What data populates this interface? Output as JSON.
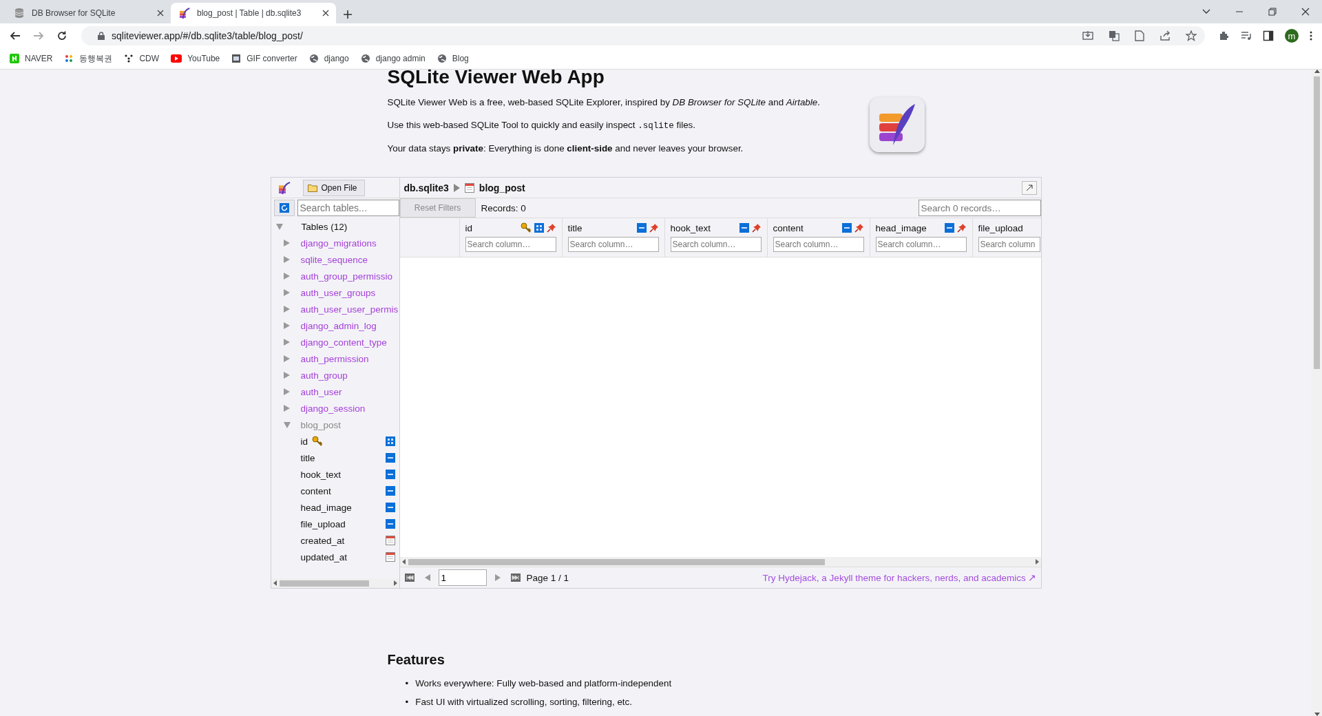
{
  "browser": {
    "tabs": [
      {
        "title": "DB Browser for SQLite",
        "selected": false,
        "kind": "database"
      },
      {
        "title": "blog_post | Table | db.sqlite3",
        "selected": true,
        "kind": "feather"
      }
    ],
    "url": "sqliteviewer.app/#/db.sqlite3/table/blog_post/",
    "bookmarks": [
      {
        "label": "NAVER",
        "kind": "naver"
      },
      {
        "label": "동행복권",
        "kind": "lottery"
      },
      {
        "label": "CDW",
        "kind": "dots"
      },
      {
        "label": "YouTube",
        "kind": "youtube"
      },
      {
        "label": "GIF converter",
        "kind": "gif"
      },
      {
        "label": "django",
        "kind": "globe"
      },
      {
        "label": "django admin",
        "kind": "globe"
      },
      {
        "label": "Blog",
        "kind": "globe"
      }
    ],
    "profile_initial": "m"
  },
  "page": {
    "title": "SQLite Viewer Web App",
    "intro": [
      "SQLite Viewer Web is a free, web-based SQLite Explorer, inspired by *DB Browser for SQLite* and *Airtable*.",
      {
        "before": "Use this web-based SQLite Tool to quickly and easily inspect ",
        "code": ".sqlite",
        "after": " files."
      },
      "Your data stays **private**: Everything is done **client-side** and never leaves your browser."
    ],
    "features_title": "Features",
    "features": [
      {
        "bullet": "•",
        "text": "Works everywhere: Fully web-based and platform-independent"
      },
      {
        "bullet": "•",
        "text": "Fast UI with virtualized scrolling, sorting, filtering, etc."
      }
    ]
  },
  "viewer": {
    "open_file": "Open File",
    "search_tables_placeholder": "Search tables...",
    "tree": {
      "label": "Tables (12)",
      "expanded": true,
      "children": [
        {
          "name": "django_migrations",
          "expanded": false,
          "selected": false
        },
        {
          "name": "sqlite_sequence",
          "expanded": false,
          "selected": false
        },
        {
          "name": "auth_group_permissio",
          "expanded": false,
          "selected": false
        },
        {
          "name": "auth_user_groups",
          "expanded": false,
          "selected": false
        },
        {
          "name": "auth_user_user_permis",
          "expanded": false,
          "selected": false
        },
        {
          "name": "django_admin_log",
          "expanded": false,
          "selected": false
        },
        {
          "name": "django_content_type",
          "expanded": false,
          "selected": false
        },
        {
          "name": "auth_permission",
          "expanded": false,
          "selected": false
        },
        {
          "name": "auth_group",
          "expanded": false,
          "selected": false
        },
        {
          "name": "auth_user",
          "expanded": false,
          "selected": false
        },
        {
          "name": "django_session",
          "expanded": false,
          "selected": false
        },
        {
          "name": "blog_post",
          "expanded": true,
          "selected": true,
          "children": [
            {
              "name": "id",
              "kind": "integer",
              "primary_key": true
            },
            {
              "name": "title",
              "kind": "text",
              "primary_key": false
            },
            {
              "name": "hook_text",
              "kind": "text",
              "primary_key": false
            },
            {
              "name": "content",
              "kind": "text",
              "primary_key": false
            },
            {
              "name": "head_image",
              "kind": "text",
              "primary_key": false
            },
            {
              "name": "file_upload",
              "kind": "text",
              "primary_key": false
            },
            {
              "name": "created_at",
              "kind": "datetime",
              "primary_key": false
            },
            {
              "name": "updated_at",
              "kind": "datetime",
              "primary_key": false
            }
          ]
        }
      ]
    },
    "breadcrumb": {
      "database": "db.sqlite3",
      "table": "blog_post"
    },
    "reset_filters": {
      "label": "Reset Filters",
      "disabled": true
    },
    "records": "Records: 0",
    "search_records_placeholder": "Search 0 records…",
    "columns": [
      {
        "name": "id",
        "kind": "integer",
        "primary_key": true,
        "placeholder": "Search column…"
      },
      {
        "name": "title",
        "kind": "text",
        "primary_key": false,
        "placeholder": "Search column…"
      },
      {
        "name": "hook_text",
        "kind": "text",
        "primary_key": false,
        "placeholder": "Search column…"
      },
      {
        "name": "content",
        "kind": "text",
        "primary_key": false,
        "placeholder": "Search column…"
      },
      {
        "name": "head_image",
        "kind": "text",
        "primary_key": false,
        "placeholder": "Search column…"
      },
      {
        "name": "file_upload",
        "primary_key": false,
        "placeholder": "Search column"
      }
    ],
    "page_input": "1",
    "page_label": "Page 1 / 1",
    "promo_link": "Try Hydejack, a Jekyll theme for hackers, nerds, and academics ↗"
  }
}
